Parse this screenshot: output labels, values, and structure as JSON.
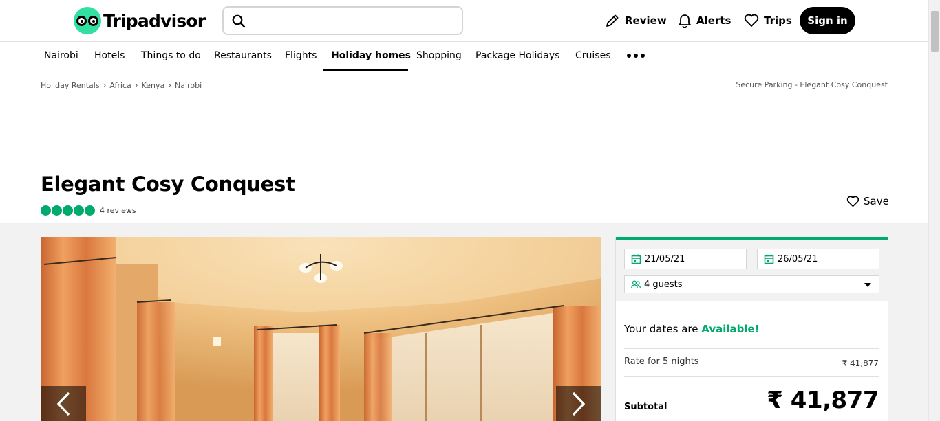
{
  "header": {
    "logo_text": "Tripadvisor",
    "search_placeholder": "",
    "actions": [
      {
        "label": "Review",
        "icon": "pencil-icon"
      },
      {
        "label": "Alerts",
        "icon": "bell-icon"
      },
      {
        "label": "Trips",
        "icon": "heart-icon"
      }
    ],
    "sign_in_label": "Sign in"
  },
  "subnav": {
    "items": [
      "Nairobi",
      "Hotels",
      "Things to do",
      "Restaurants",
      "Flights",
      "Holiday homes",
      "Shopping",
      "Package Holidays",
      "Cruises"
    ],
    "active": "Holiday homes",
    "more_icon": "more-dots-icon"
  },
  "breadcrumb": {
    "items": [
      "Holiday Rentals",
      "Africa",
      "Kenya",
      "Nairobi"
    ],
    "current": "Secure Parking - Elegant Cosy Conquest"
  },
  "listing": {
    "title": "Elegant Cosy Conquest",
    "rating_bubbles": 5,
    "reviews_label": "4 reviews",
    "save_label": "Save"
  },
  "booking": {
    "checkin": "21/05/21",
    "checkout": "26/05/21",
    "guests": "4 guests",
    "availability_prefix": "Your dates are",
    "availability_status": "Available!",
    "rate_label": "Rate for 5 nights",
    "rate_value": "₹ 41,877",
    "subtotal_label": "Subtotal",
    "subtotal_value": "₹ 41,877"
  },
  "colors": {
    "brand_green": "#34e0a1",
    "rating_green": "#00aa6c",
    "sign_in_bg": "#000000"
  }
}
